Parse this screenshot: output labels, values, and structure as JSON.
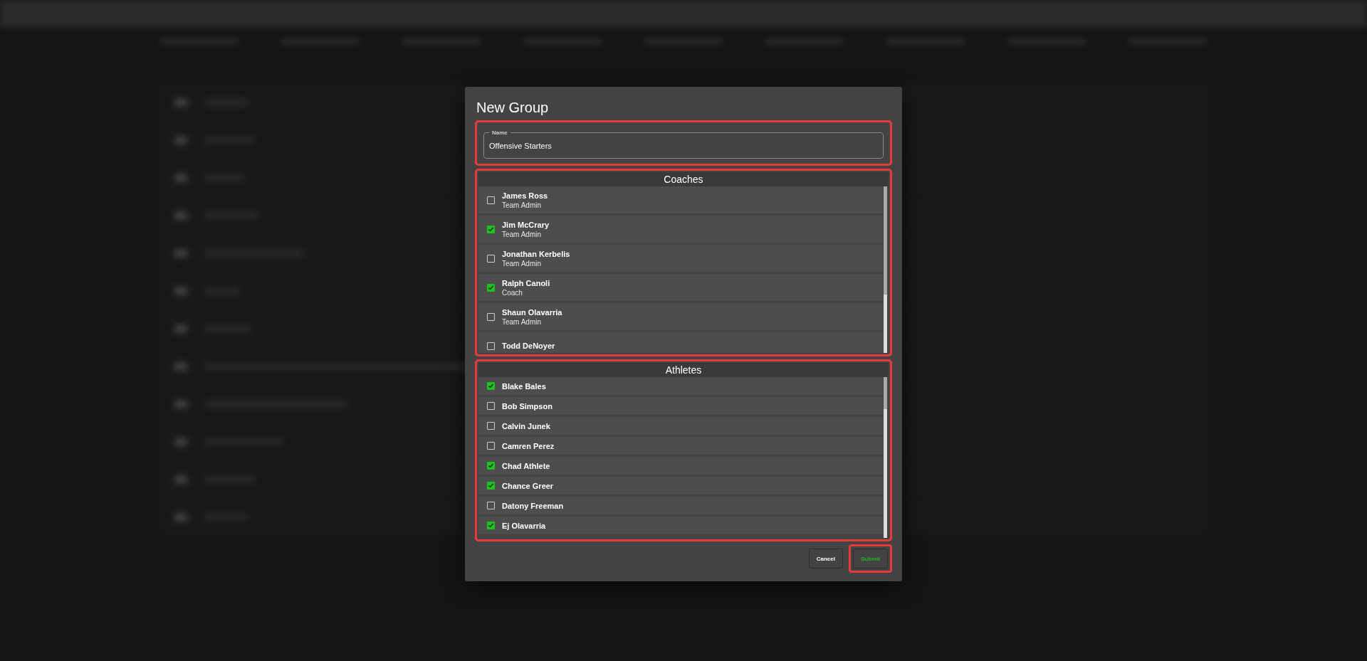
{
  "dialog": {
    "title": "New Group",
    "name_field": {
      "label": "Name",
      "value": "Offensive Starters",
      "highlighted": true
    },
    "coaches": {
      "title": "Coaches",
      "highlighted": true,
      "members": [
        {
          "name": "James Ross",
          "role": "Team Admin",
          "checked": false
        },
        {
          "name": "Jim McCrary",
          "role": "Team Admin",
          "checked": true
        },
        {
          "name": "Jonathan Kerbelis",
          "role": "Team Admin",
          "checked": false
        },
        {
          "name": "Ralph Canoli",
          "role": "Coach",
          "checked": true
        },
        {
          "name": "Shaun Olavarria",
          "role": "Team Admin",
          "checked": false
        },
        {
          "name": "Todd DeNoyer",
          "checked": false
        }
      ]
    },
    "athletes": {
      "title": "Athletes",
      "highlighted": true,
      "members": [
        {
          "name": "Blake Bales",
          "checked": true
        },
        {
          "name": "Bob Simpson",
          "checked": false
        },
        {
          "name": "Calvin Junek",
          "checked": false
        },
        {
          "name": "Camren Perez",
          "checked": false
        },
        {
          "name": "Chad Athlete",
          "checked": true
        },
        {
          "name": "Chance Greer",
          "checked": true
        },
        {
          "name": "Datony Freeman",
          "checked": false
        },
        {
          "name": "Ej Olavarria",
          "checked": true
        }
      ]
    },
    "buttons": [
      {
        "kind": "cancel",
        "label": "Cancel",
        "highlighted": false
      },
      {
        "kind": "submit",
        "label": "Submit",
        "highlighted": true
      }
    ]
  }
}
